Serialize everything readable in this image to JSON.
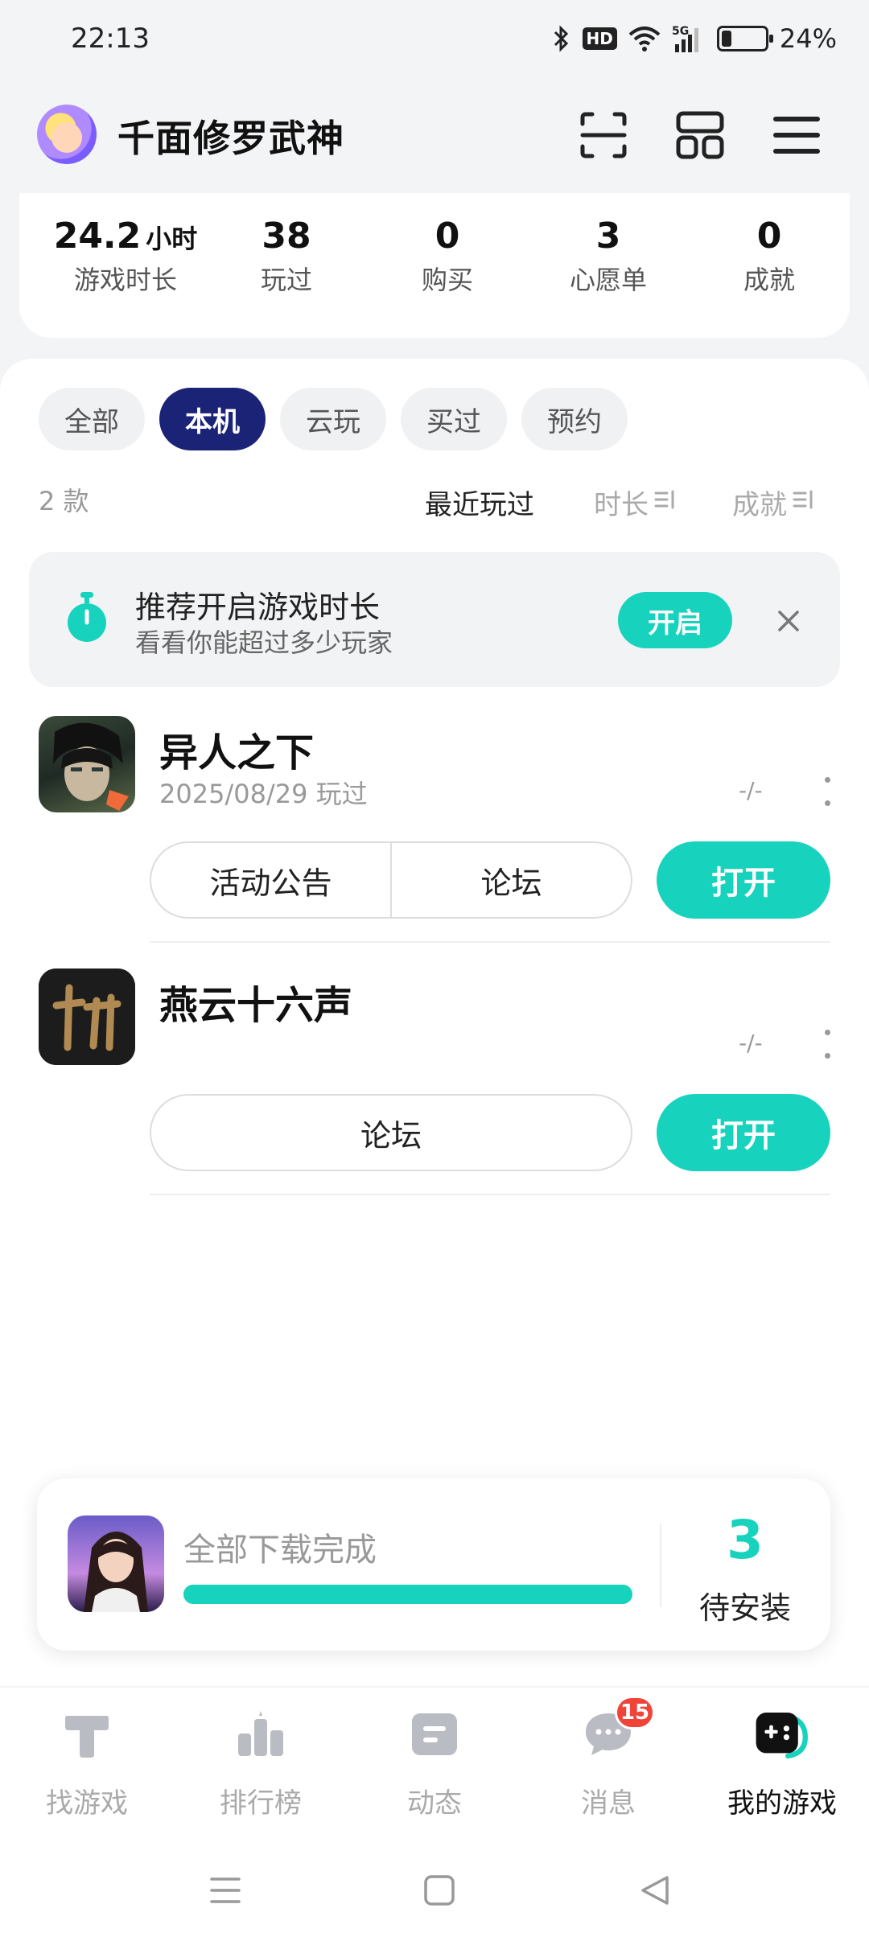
{
  "status_bar": {
    "time": "22:13",
    "hd_label": "HD",
    "network": "5G",
    "battery_text": "24%",
    "battery_level": 0.24
  },
  "header": {
    "username": "千面修罗武神",
    "icons": [
      "scan-icon",
      "apps-grid-icon",
      "menu-icon"
    ]
  },
  "stats": [
    {
      "value": "24.2",
      "unit": "小时",
      "label": "游戏时长"
    },
    {
      "value": "38",
      "unit": "",
      "label": "玩过"
    },
    {
      "value": "0",
      "unit": "",
      "label": "购买"
    },
    {
      "value": "3",
      "unit": "",
      "label": "心愿单"
    },
    {
      "value": "0",
      "unit": "",
      "label": "成就"
    }
  ],
  "filters": {
    "chips": [
      "全部",
      "本机",
      "云玩",
      "买过",
      "预约"
    ],
    "active": "本机",
    "count": "2 款",
    "sorts": [
      "最近玩过",
      "时长",
      "成就"
    ],
    "active_sort": "最近玩过"
  },
  "banner": {
    "title": "推荐开启游戏时长",
    "subtitle": "看看你能超过多少玩家",
    "button": "开启"
  },
  "games": [
    {
      "name": "异人之下",
      "played": "2025/08/29 玩过",
      "meta": "-/-",
      "actions": [
        "活动公告",
        "论坛"
      ],
      "open": "打开"
    },
    {
      "name": "燕云十六声",
      "played": "",
      "meta": "-/-",
      "actions": [
        "论坛"
      ],
      "open": "打开"
    }
  ],
  "download": {
    "status": "全部下载完成",
    "progress": 1.0,
    "pending_count": "3",
    "pending_label": "待安装"
  },
  "bottom_nav": {
    "items": [
      "找游戏",
      "排行榜",
      "动态",
      "消息",
      "我的游戏"
    ],
    "active": "我的游戏",
    "message_badge": "15"
  },
  "colors": {
    "accent": "#17d3bd",
    "active_chip": "#1b2377",
    "badge": "#f04438"
  }
}
